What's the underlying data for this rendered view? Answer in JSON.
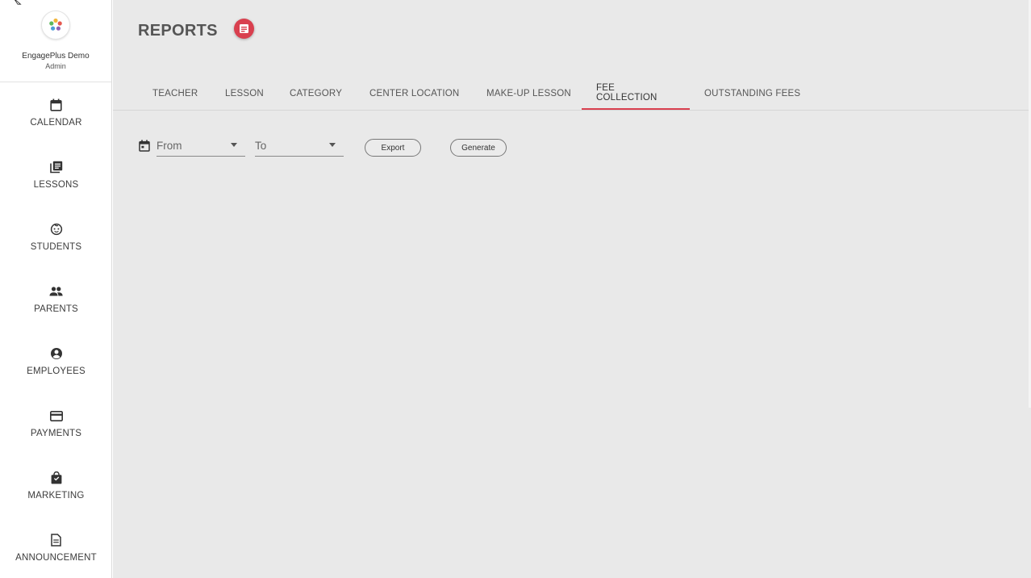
{
  "sidebar": {
    "profile": {
      "name": "EngagePlus Demo",
      "role": "Admin",
      "logo_icon": "flower-logo-icon"
    },
    "items": [
      {
        "label": "CALENDAR",
        "icon": "calendar-icon"
      },
      {
        "label": "LESSONS",
        "icon": "library-books-icon"
      },
      {
        "label": "STUDENTS",
        "icon": "child-face-icon"
      },
      {
        "label": "PARENTS",
        "icon": "people-icon"
      },
      {
        "label": "EMPLOYEES",
        "icon": "account-circle-icon"
      },
      {
        "label": "PAYMENTS",
        "icon": "credit-card-icon"
      },
      {
        "label": "MARKETING",
        "icon": "shopping-bag-icon"
      },
      {
        "label": "ANNOUNCEMENT",
        "icon": "document-icon"
      }
    ]
  },
  "header": {
    "title": "REPORTS",
    "badge_icon": "report-icon"
  },
  "tabs": [
    {
      "label": "TEACHER"
    },
    {
      "label": "LESSON"
    },
    {
      "label": "CATEGORY"
    },
    {
      "label": "CENTER LOCATION"
    },
    {
      "label": "MAKE-UP LESSON"
    },
    {
      "label": "FEE COLLECTION",
      "active": true
    },
    {
      "label": "OUTSTANDING FEES"
    }
  ],
  "filters": {
    "from_label": "From",
    "to_label": "To",
    "export_label": "Export",
    "generate_label": "Generate"
  },
  "colors": {
    "accent": "#d9404f",
    "background": "#e9e9e9",
    "sidebar": "#ffffff"
  }
}
